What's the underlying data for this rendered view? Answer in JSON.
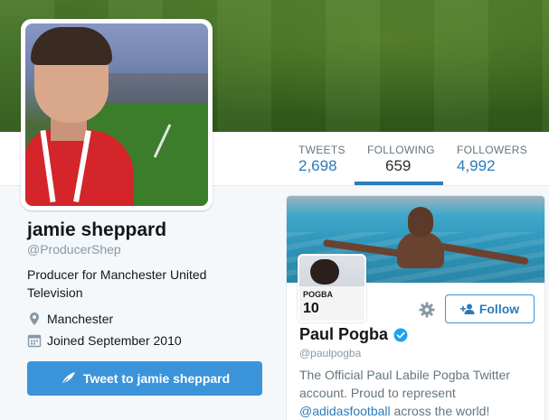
{
  "profile": {
    "name": "jamie sheppard",
    "handle": "@ProducerShep",
    "bio": "Producer for Manchester United Television",
    "location": "Manchester",
    "joined": "Joined September 2010",
    "tweet_to_label": "Tweet to jamie sheppard"
  },
  "nav": {
    "tweets": {
      "label": "TWEETS",
      "value": "2,698"
    },
    "following": {
      "label": "FOLLOWING",
      "value": "659"
    },
    "followers": {
      "label": "FOLLOWERS",
      "value": "4,992"
    }
  },
  "card": {
    "name": "Paul Pogba",
    "handle": "@paulpogba",
    "follow_label": "Follow",
    "bio_before": "The Official Paul Labile Pogba Twitter account. Proud to represent ",
    "bio_mention": "@adidasfootball",
    "bio_after": " across the world!",
    "avatar_text": "POGBA",
    "avatar_number": "10"
  },
  "colors": {
    "accent": "#2b7bb9",
    "button": "#3b94d9",
    "verified": "#1da1f2"
  },
  "icons": [
    "location-pin-icon",
    "calendar-icon",
    "feather-icon",
    "gear-icon",
    "add-user-icon",
    "verified-badge-icon"
  ]
}
